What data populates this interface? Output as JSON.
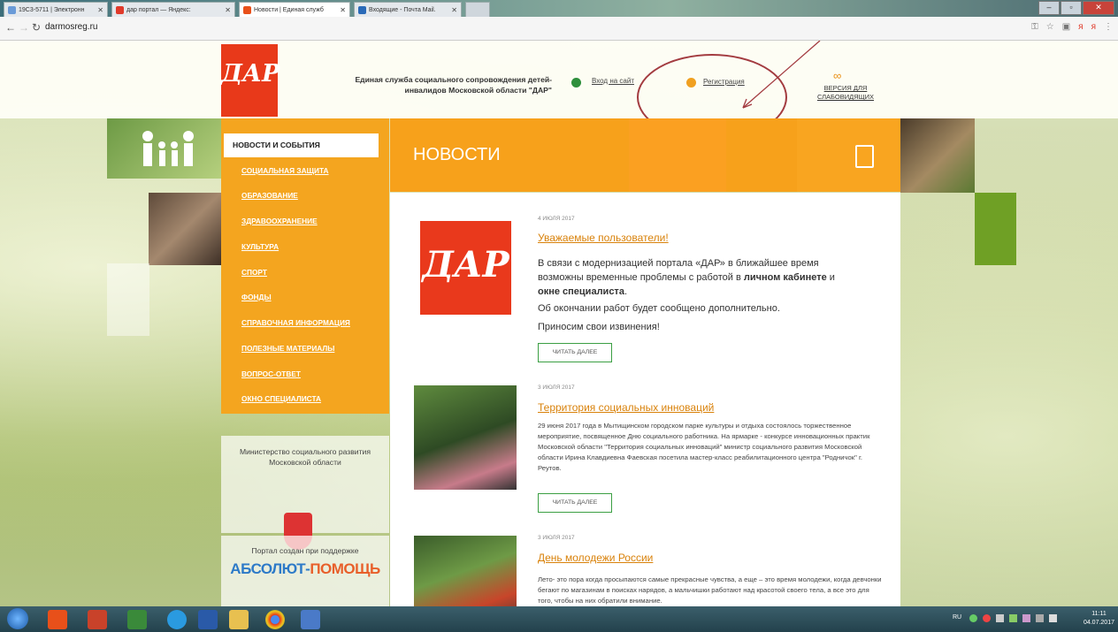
{
  "browser": {
    "tabs": [
      {
        "label": "19С3-5711 | Электронн",
        "fav_color": "#6a9bd8"
      },
      {
        "label": "дар портал — Яндекс:",
        "fav_color": "#e03a2a"
      },
      {
        "label": "Новости | Единая служб",
        "fav_color": "#e8501a"
      },
      {
        "label": "Входящие - Почта Mail.",
        "fav_color": "#2a6ab8"
      }
    ],
    "url": "darmosreg.ru",
    "window_controls": [
      "–",
      "▫",
      "✕"
    ]
  },
  "header": {
    "logo": "ДАР",
    "site_title": "Единая служба социального сопровождения детей-инвалидов Московской области \"ДАР\"",
    "login_label": "Вход на сайт",
    "register_label": "Регистрация",
    "vision_label": "ВЕРСИЯ ДЛЯ СЛАБОВИДЯЩИХ",
    "accent_color": "#f4a51f"
  },
  "sidebar": {
    "active_item": "НОВОСТИ И СОБЫТИЯ",
    "items": [
      "СОЦИАЛЬНАЯ ЗАЩИТА",
      "ОБРАЗОВАНИЕ",
      "ЗДРАВООХРАНЕНИЕ",
      "КУЛЬТУРА",
      "СПОРТ",
      "ФОНДЫ",
      "СПРАВОЧНАЯ ИНФОРМАЦИЯ",
      "ПОЛЕЗНЫЕ МАТЕРИАЛЫ",
      "ВОПРОС-ОТВЕТ",
      "ОКНО СПЕЦИАЛИСТА"
    ],
    "ministry": "Министерство социального развития Московской области",
    "support": "Портал создан при поддержке",
    "support_logo_a": "АБСОЛЮТ-",
    "support_logo_b": "ПОМОЩЬ"
  },
  "news": {
    "banner_title": "НОВОСТИ",
    "read_more": "ЧИТАТЬ ДАЛЕЕ",
    "items": [
      {
        "date": "4 ИЮЛЯ 2017",
        "title": "Уважаемые пользователи!",
        "thumb": "ДАР",
        "text1a": "В связи с модернизацией портала «ДАР» в ближайшее время возможны временные проблемы с работой в ",
        "text1b": "личном кабинете",
        "text1c": " и ",
        "text1d": "окне специалиста",
        "text1e": ".",
        "text2": "Об окончании работ будет сообщено дополнительно.",
        "text3": "Приносим свои извинения!"
      },
      {
        "date": "3 ИЮЛЯ 2017",
        "title": "Территория социальных инноваций",
        "text": "29 июня 2017 года в Мытищинском городском парке культуры и отдыха состоялось торжественное мероприятие, посвященное Дню социального работника. На ярмарке - конкурсе инновационных практик Московской области \"Территория социальных инноваций\" министр социального развития Московской области Ирина Клавдиевна Фаевская посетила мастер-класс реабилитационного центра \"Родничок\" г. Реутов."
      },
      {
        "date": "3 ИЮЛЯ 2017",
        "title": "День молодежи России",
        "text": "Лето- это пора когда просыпаются самые прекрасные чувства, а еще – это время молодежи, когда девчонки бегают по магазинам в поисках нарядов, а мальчишки работают над красотой своего тела, а все это для того, чтобы на них обратили внимание."
      }
    ]
  },
  "taskbar": {
    "lang": "RU",
    "time": "11:11",
    "date": "04.07.2017"
  }
}
